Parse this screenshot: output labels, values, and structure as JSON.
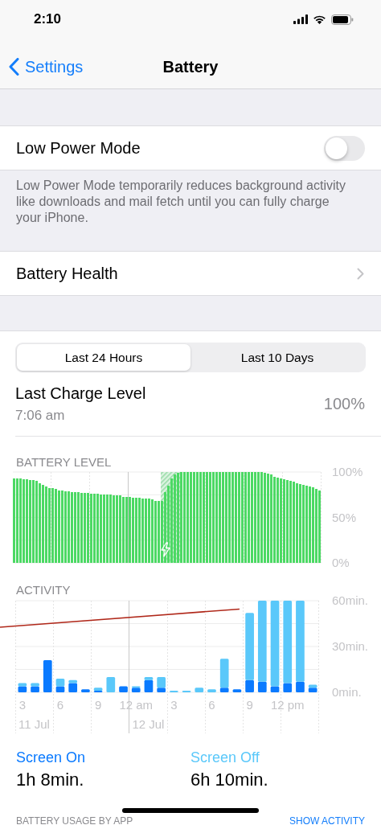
{
  "status_bar": {
    "time": "2:10"
  },
  "nav": {
    "back": "Settings",
    "title": "Battery"
  },
  "low_power": {
    "label": "Low Power Mode",
    "on": false,
    "footer": "Low Power Mode temporarily reduces background activity like downloads and mail fetch until you can fully charge your iPhone."
  },
  "battery_health": {
    "label": "Battery Health"
  },
  "segments": [
    {
      "label": "Last 24 Hours",
      "selected": true
    },
    {
      "label": "Last 10 Days",
      "selected": false
    }
  ],
  "last_charge": {
    "label": "Last Charge Level",
    "time": "7:06 am",
    "value": "100%"
  },
  "battery_level": {
    "title": "BATTERY LEVEL",
    "chart_data": {
      "type": "bar",
      "ylim": [
        0,
        100
      ],
      "values": [
        93,
        93,
        93,
        92,
        92,
        91,
        91,
        90,
        88,
        86,
        84,
        82,
        82,
        81,
        80,
        80,
        79,
        79,
        78,
        78,
        78,
        77,
        77,
        77,
        76,
        76,
        76,
        75,
        75,
        75,
        75,
        74,
        74,
        74,
        73,
        73,
        73,
        72,
        72,
        72,
        71,
        71,
        71,
        70,
        68,
        68,
        68,
        78,
        85,
        93,
        97,
        99,
        100,
        100,
        100,
        100,
        100,
        100,
        100,
        100,
        100,
        100,
        100,
        100,
        100,
        100,
        100,
        100,
        100,
        100,
        100,
        100,
        100,
        100,
        100,
        100,
        100,
        100,
        99,
        98,
        97,
        95,
        94,
        93,
        92,
        91,
        90,
        89,
        88,
        87,
        86,
        85,
        84,
        83,
        81,
        80
      ],
      "yticks": [
        {
          "value": 0,
          "label": "0%"
        },
        {
          "value": 50,
          "label": "50%"
        },
        {
          "value": 100,
          "label": "100%"
        }
      ]
    }
  },
  "activity": {
    "title": "ACTIVITY",
    "chart_data": {
      "type": "bar",
      "stacked": true,
      "ylim": [
        0,
        60
      ],
      "categories": [
        "3",
        null,
        null,
        "6",
        null,
        null,
        "9",
        null,
        null,
        "12 am",
        null,
        null,
        "3",
        null,
        null,
        "6",
        null,
        null,
        "9",
        null,
        null,
        "12 pm",
        null,
        null
      ],
      "series": [
        {
          "name": "Screen On",
          "color": "#0a7aff",
          "values": [
            4,
            4,
            21,
            4,
            6,
            2,
            1,
            0,
            4,
            3,
            8,
            3,
            0,
            0,
            0,
            0,
            3,
            2,
            8,
            7,
            4,
            6,
            7,
            3
          ]
        },
        {
          "name": "Screen Off",
          "color": "#5ac8fa",
          "values": [
            2,
            2,
            0,
            5,
            2,
            0,
            2,
            10,
            0,
            1,
            2,
            7,
            1,
            1,
            3,
            2,
            19,
            0,
            44,
            53,
            56,
            54,
            53,
            2
          ]
        }
      ],
      "yticks": [
        {
          "value": 0,
          "label": "0min."
        },
        {
          "value": 30,
          "label": "30min."
        },
        {
          "value": 60,
          "label": "60min."
        }
      ],
      "annotations": [
        "11 Jul",
        "12 Jul"
      ]
    }
  },
  "screen_time": [
    {
      "value": "1h 8min."
    },
    {
      "value": "6h 10min."
    }
  ],
  "usage_header": {
    "title": "BATTERY USAGE BY APP",
    "action": "SHOW ACTIVITY"
  }
}
